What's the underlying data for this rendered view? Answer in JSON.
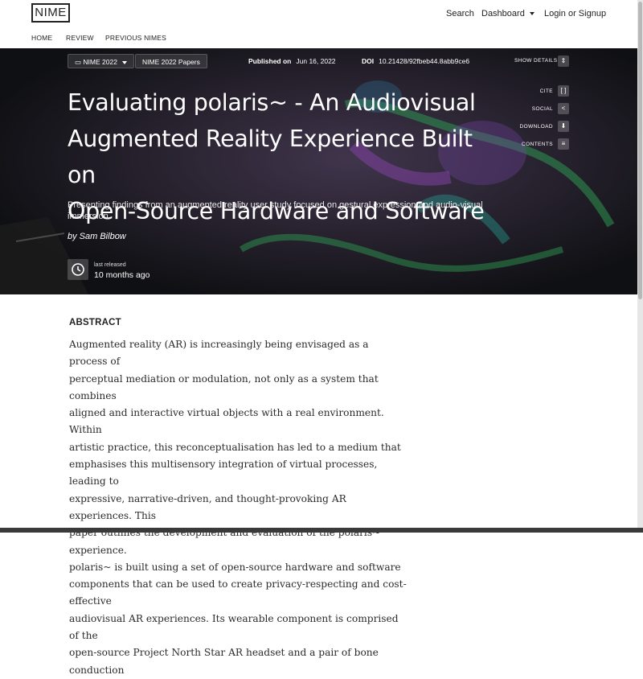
{
  "brand": {
    "logo": "NIME"
  },
  "header": {
    "search": "Search",
    "dashboard": "Dashboard",
    "login": "Login or Signup"
  },
  "subnav": {
    "home": "HOME",
    "review": "REVIEW",
    "previous": "PREVIOUS NIMES"
  },
  "hero": {
    "community_pill": "NIME 2022",
    "collection_pill": "NIME 2022 Papers",
    "published_label": "Published on",
    "published_date": "Jun 16, 2022",
    "doi_label": "DOI",
    "doi_value": "10.21428/92fbeb44.8abb9ce6",
    "show_details": "SHOW DETAILS",
    "actions": {
      "cite": "CITE",
      "social": "SOCIAL",
      "download": "DOWNLOAD",
      "contents": "CONTENTS"
    },
    "title_line1": "Evaluating polaris~ - An Audiovisual",
    "title_line2": "Augmented Reality Experience Built on",
    "title_line3": "Open-Source Hardware and Software",
    "subtitle": "Presenting findings from an augmented reality user study focused on gestural expression and audio-visual immersion.",
    "byline": "by Sam Bilbow",
    "release_label": "last released",
    "release_value": "10 months ago"
  },
  "abstract": {
    "heading": "ABSTRACT",
    "lines": [
      "Augmented reality (AR) is increasingly being envisaged as a process of",
      "perceptual mediation or modulation, not only as a system that combines",
      "aligned and interactive virtual objects with a real environment. Within",
      "artistic practice, this reconceptualisation has led to a medium that",
      "emphasises this multisensory integration of virtual processes, leading to",
      "expressive, narrative-driven, and thought-provoking AR experiences. This",
      "paper outlines the development and evaluation of the polaris~ experience.",
      "polaris~ is built using a set of open-source hardware and software",
      "components that can be used to create privacy-respecting and cost-effective",
      "audiovisual AR experiences. Its wearable component is comprised of the",
      "open-source Project North Star AR headset and a pair of bone conduction"
    ]
  },
  "colors": {
    "hero_overlay": "#1a1c20",
    "accent_green": "#2fd36a",
    "accent_purple": "#8a4fd8"
  }
}
